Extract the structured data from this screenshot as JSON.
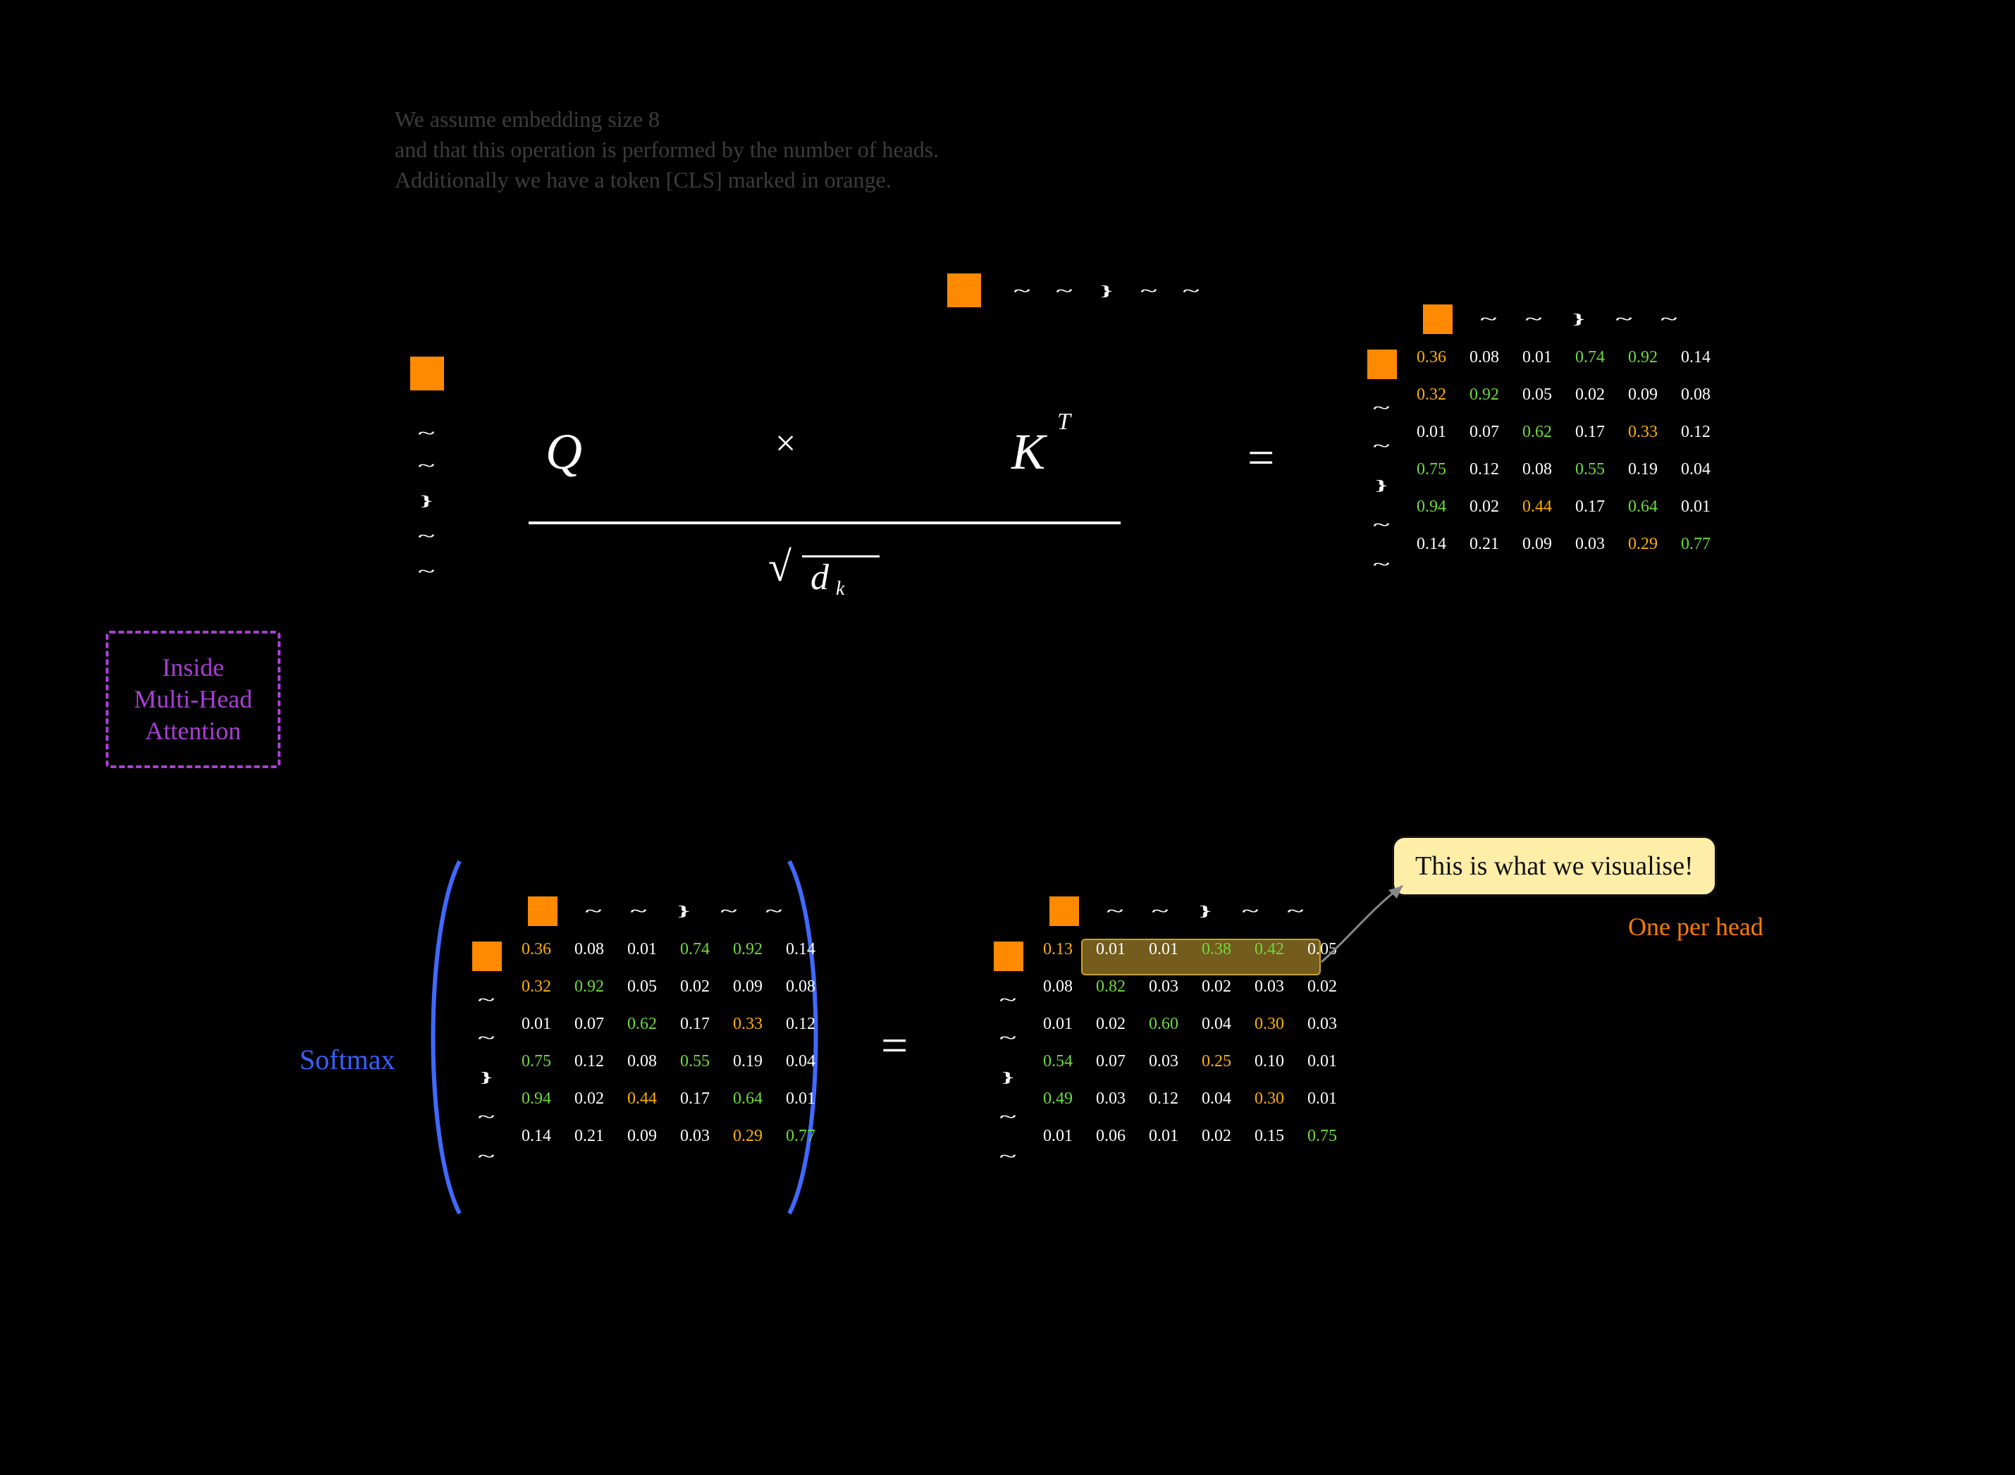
{
  "note": {
    "line1": "We assume embedding size 8",
    "line2": "and that this operation is performed by the number of heads.",
    "line3": "Additionally we have a token [CLS] marked in orange."
  },
  "boxes": {
    "mha_line1": "Inside",
    "mha_line2": "Multi-Head",
    "mha_line3": "Attention"
  },
  "labels": {
    "softmax": "Softmax",
    "callout": "This is what we visualise!",
    "one_per_head": "One per head"
  },
  "math": {
    "Q": "Q",
    "K": "K",
    "T": "T",
    "over": "√",
    "dk": "d",
    "ksub": "k",
    "eq": "=",
    "x": "×"
  },
  "glyph_rows": [
    "~",
    "~",
    "}",
    "~",
    "~"
  ],
  "matrix_A": [
    [
      {
        "v": "0.36",
        "c": "yellow"
      },
      {
        "v": "0.08"
      },
      {
        "v": "0.01"
      },
      {
        "v": "0.74",
        "c": "green"
      },
      {
        "v": "0.92",
        "c": "green"
      },
      {
        "v": "0.14"
      }
    ],
    [
      {
        "v": "0.32",
        "c": "yellow"
      },
      {
        "v": "0.92",
        "c": "green"
      },
      {
        "v": "0.05"
      },
      {
        "v": "0.02"
      },
      {
        "v": "0.09"
      },
      {
        "v": "0.08"
      }
    ],
    [
      {
        "v": "0.01"
      },
      {
        "v": "0.07"
      },
      {
        "v": "0.62",
        "c": "green"
      },
      {
        "v": "0.17"
      },
      {
        "v": "0.33",
        "c": "yellow"
      },
      {
        "v": "0.12"
      }
    ],
    [
      {
        "v": "0.75",
        "c": "green"
      },
      {
        "v": "0.12"
      },
      {
        "v": "0.08"
      },
      {
        "v": "0.55",
        "c": "green"
      },
      {
        "v": "0.19"
      },
      {
        "v": "0.04"
      }
    ],
    [
      {
        "v": "0.94",
        "c": "green"
      },
      {
        "v": "0.02"
      },
      {
        "v": "0.44",
        "c": "yellow"
      },
      {
        "v": "0.17"
      },
      {
        "v": "0.64",
        "c": "green"
      },
      {
        "v": "0.01"
      }
    ],
    [
      {
        "v": "0.14"
      },
      {
        "v": "0.21"
      },
      {
        "v": "0.09"
      },
      {
        "v": "0.03"
      },
      {
        "v": "0.29",
        "c": "yellow"
      },
      {
        "v": "0.77",
        "c": "green"
      }
    ]
  ],
  "matrix_B": [
    [
      {
        "v": "0.13",
        "c": "yellow"
      },
      {
        "v": "0.01"
      },
      {
        "v": "0.01"
      },
      {
        "v": "0.38",
        "c": "green"
      },
      {
        "v": "0.42",
        "c": "green"
      },
      {
        "v": "0.05"
      }
    ],
    [
      {
        "v": "0.08"
      },
      {
        "v": "0.82",
        "c": "green"
      },
      {
        "v": "0.03"
      },
      {
        "v": "0.02"
      },
      {
        "v": "0.03"
      },
      {
        "v": "0.02"
      }
    ],
    [
      {
        "v": "0.01"
      },
      {
        "v": "0.02"
      },
      {
        "v": "0.60",
        "c": "green"
      },
      {
        "v": "0.04"
      },
      {
        "v": "0.30",
        "c": "yellow"
      },
      {
        "v": "0.03"
      }
    ],
    [
      {
        "v": "0.54",
        "c": "green"
      },
      {
        "v": "0.07"
      },
      {
        "v": "0.03"
      },
      {
        "v": "0.25",
        "c": "yellow"
      },
      {
        "v": "0.10"
      },
      {
        "v": "0.01"
      }
    ],
    [
      {
        "v": "0.49",
        "c": "green"
      },
      {
        "v": "0.03"
      },
      {
        "v": "0.12"
      },
      {
        "v": "0.04"
      },
      {
        "v": "0.30",
        "c": "yellow"
      },
      {
        "v": "0.01"
      }
    ],
    [
      {
        "v": "0.01"
      },
      {
        "v": "0.06"
      },
      {
        "v": "0.01"
      },
      {
        "v": "0.02"
      },
      {
        "v": "0.15"
      },
      {
        "v": "0.75",
        "c": "green"
      }
    ]
  ]
}
